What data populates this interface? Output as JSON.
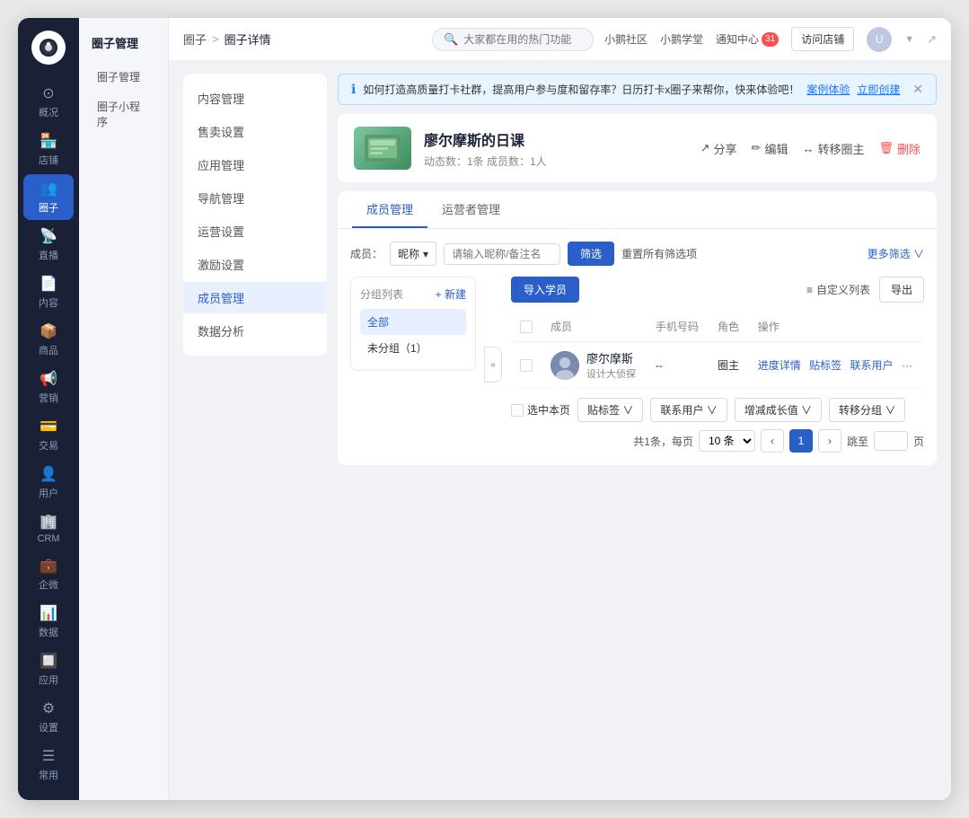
{
  "app": {
    "logo": "🎵"
  },
  "sidebar": {
    "items": [
      {
        "id": "overview",
        "label": "概况",
        "icon": "⊙"
      },
      {
        "id": "store",
        "label": "店铺",
        "icon": "🏪"
      },
      {
        "id": "circle",
        "label": "圈子",
        "icon": "👥",
        "active": true
      },
      {
        "id": "live",
        "label": "直播",
        "icon": "📡"
      },
      {
        "id": "content",
        "label": "内容",
        "icon": "📄"
      },
      {
        "id": "goods",
        "label": "商品",
        "icon": "📦"
      },
      {
        "id": "marketing",
        "label": "营销",
        "icon": "📢"
      },
      {
        "id": "transaction",
        "label": "交易",
        "icon": "💳"
      },
      {
        "id": "user",
        "label": "用户",
        "icon": "👤"
      },
      {
        "id": "crm",
        "label": "CRM",
        "icon": "🏢"
      },
      {
        "id": "enterprise",
        "label": "企微",
        "icon": "💼"
      },
      {
        "id": "data",
        "label": "数据",
        "icon": "📊"
      },
      {
        "id": "apps",
        "label": "应用",
        "icon": "🔲"
      },
      {
        "id": "settings",
        "label": "设置",
        "icon": "⚙"
      },
      {
        "id": "common",
        "label": "常用",
        "icon": "☰"
      }
    ]
  },
  "sidebar2": {
    "title": "圈子管理",
    "items": [
      {
        "id": "manage",
        "label": "圈子管理",
        "active": false
      },
      {
        "id": "miniapp",
        "label": "圈子小程序",
        "active": false
      }
    ]
  },
  "topbar": {
    "breadcrumb": {
      "parent": "圈子",
      "sep": ">",
      "current": "圈子详情"
    },
    "search_placeholder": "大家都在用的热门功能",
    "nav_items": [
      "小鹅社区",
      "小鹅学堂"
    ],
    "notification": {
      "label": "通知中心",
      "badge": "31"
    },
    "visit_store_btn": "访问店铺",
    "avatar_text": "U"
  },
  "alert": {
    "text": "如何打造高质量打卡社群，提高用户参与度和留存率？日历打卡x圈子来帮你，快来体验吧！",
    "link_text": "案例体验",
    "create_text": "立即创建"
  },
  "circle": {
    "name": "廖尔摩斯的日课",
    "stats": "动态数：1条   成员数：1人",
    "actions": {
      "share": "分享",
      "edit": "编辑",
      "transfer": "转移圈主",
      "delete": "删除"
    }
  },
  "left_panel": {
    "items": [
      {
        "id": "content_mgr",
        "label": "内容管理"
      },
      {
        "id": "sales",
        "label": "售卖设置"
      },
      {
        "id": "app_mgr",
        "label": "应用管理"
      },
      {
        "id": "nav",
        "label": "导航管理"
      },
      {
        "id": "operation",
        "label": "运营设置"
      },
      {
        "id": "incentive",
        "label": "激励设置"
      },
      {
        "id": "member_mgr",
        "label": "成员管理",
        "active": true
      },
      {
        "id": "data_analysis",
        "label": "数据分析"
      }
    ]
  },
  "tabs": [
    {
      "id": "member",
      "label": "成员管理",
      "active": true
    },
    {
      "id": "operator",
      "label": "运营者管理"
    }
  ],
  "filter": {
    "member_label": "成员：",
    "nickname_label": "昵称",
    "input_placeholder": "请输入昵称/备注名",
    "filter_btn": "筛选",
    "reset_btn": "重置所有筛选项",
    "more_btn": "更多筛选 ∨"
  },
  "actions": {
    "import_btn": "导入学员",
    "custom_col_btn": "自定义列表",
    "export_btn": "导出"
  },
  "group_panel": {
    "title": "分组列表",
    "new_btn": "+ 新建",
    "groups": [
      {
        "id": "all",
        "label": "全部",
        "active": true
      },
      {
        "id": "unclassified",
        "label": "未分组（1）"
      }
    ]
  },
  "table": {
    "columns": [
      "成员",
      "手机号码",
      "角色",
      "操作"
    ],
    "rows": [
      {
        "id": "1",
        "name": "廖尔摩斯",
        "title": "设计大侦探",
        "phone": "--",
        "role": "圈主",
        "ops": [
          "进度详情",
          "贴标签",
          "联系用户",
          "..."
        ]
      }
    ]
  },
  "bottom_actions": {
    "select_all": "选中本页",
    "tag_btn": "贴标签 ∨",
    "contact_btn": "联系用户 ∨",
    "growth_btn": "增减成长值 ∨",
    "transfer_btn": "转移分组 ∨"
  },
  "pagination": {
    "total_text": "共1条，每页",
    "per_page": "10",
    "per_page_unit": "条 ∨",
    "prev": "<",
    "current_page": "1",
    "next": ">",
    "jump_label": "跳至",
    "jump_unit": "页"
  }
}
